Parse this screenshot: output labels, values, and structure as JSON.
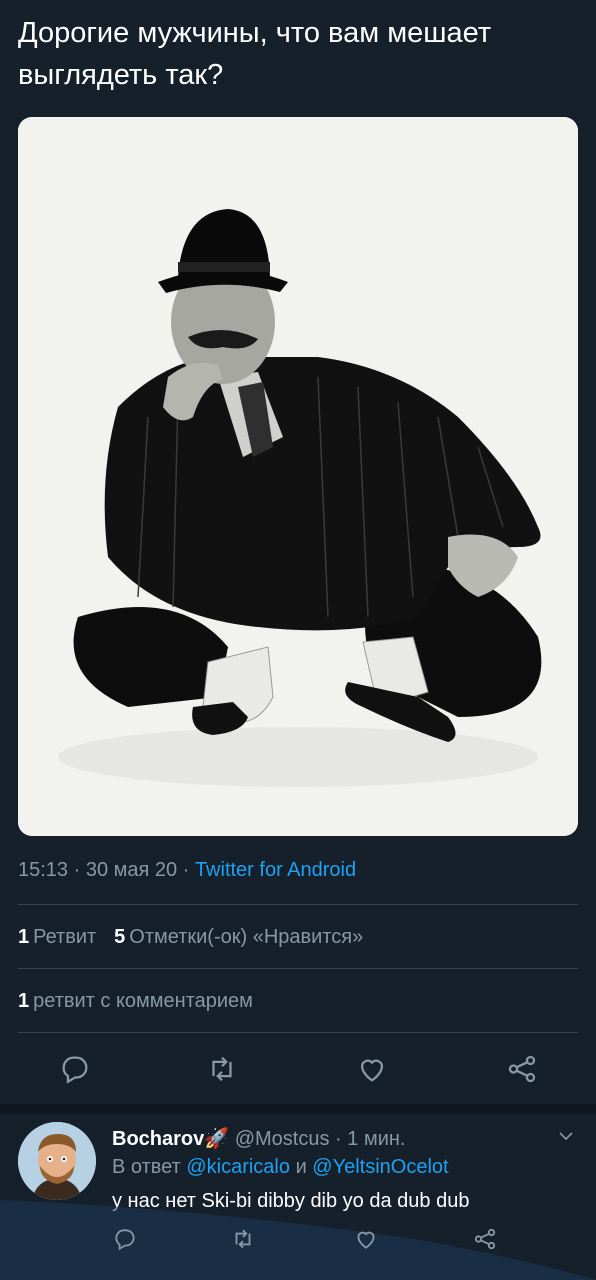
{
  "tweet": {
    "text": "Дорогие мужчины, что вам мешает выглядеть так?",
    "time": "15:13",
    "date": "30 мая 20",
    "separator": " · ",
    "source": "Twitter for Android"
  },
  "stats": {
    "retweets_count": "1",
    "retweets_label": "Ретвит",
    "likes_count": "5",
    "likes_label": "Отметки(-ок) «Нравится»",
    "quotes_count": "1",
    "quotes_label": "ретвит с комментарием"
  },
  "actions": {
    "reply_icon": "reply-icon",
    "retweet_icon": "retweet-icon",
    "like_icon": "heart-icon",
    "share_icon": "share-icon"
  },
  "reply": {
    "name": "Bocharov",
    "name_emoji": "🚀",
    "handle": "@Mostcus",
    "time": "1 мин.",
    "separator": " · ",
    "reply_prefix": "В ответ",
    "mention_1": "@kicaricalo",
    "and": "и",
    "mention_2": "@YeltsinOcelot",
    "text": "у нас нет Ski-bi dibby dib yo da dub dub"
  },
  "colors": {
    "background": "#15202b",
    "accent": "#1da1f2",
    "muted": "#8899a6",
    "divider": "#38444d"
  }
}
